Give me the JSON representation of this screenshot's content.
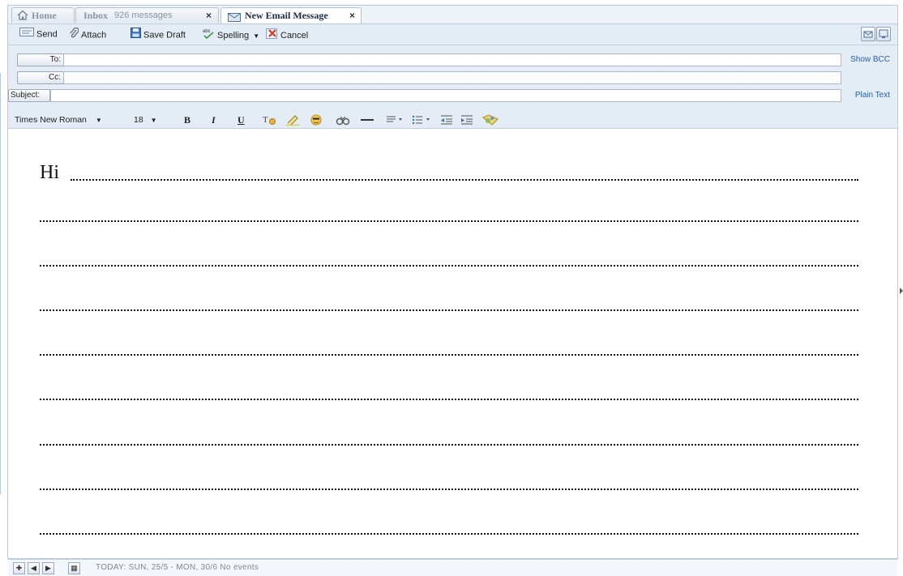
{
  "tabs": [
    {
      "label": "Home",
      "icon": "home-icon"
    },
    {
      "label": "Inbox",
      "sub": "926 messages",
      "close": "×"
    },
    {
      "label": "New Email Message",
      "icon": "envelope-icon",
      "close": "×"
    }
  ],
  "toolbar": {
    "send": "Send",
    "attach": "Attach",
    "save_draft": "Save Draft",
    "spelling": "Spelling",
    "cancel": "Cancel"
  },
  "header": {
    "to_label": "To:",
    "cc_label": "Cc:",
    "subject_label": "Subject:",
    "show_bcc": "Show BCC",
    "plain_text": "Plain Text",
    "to_value": "",
    "cc_value": "",
    "subject_value": ""
  },
  "format": {
    "font": "Times New Roman",
    "size": "18"
  },
  "body": {
    "greeting": "Hi"
  },
  "status": {
    "text": "TODAY: SUN, 25/5 - MON, 30/6  No events"
  },
  "colors": {
    "accent": "#2a5ea8",
    "toolbar_bg": "#e4ecf6",
    "border": "#b9c9de"
  }
}
